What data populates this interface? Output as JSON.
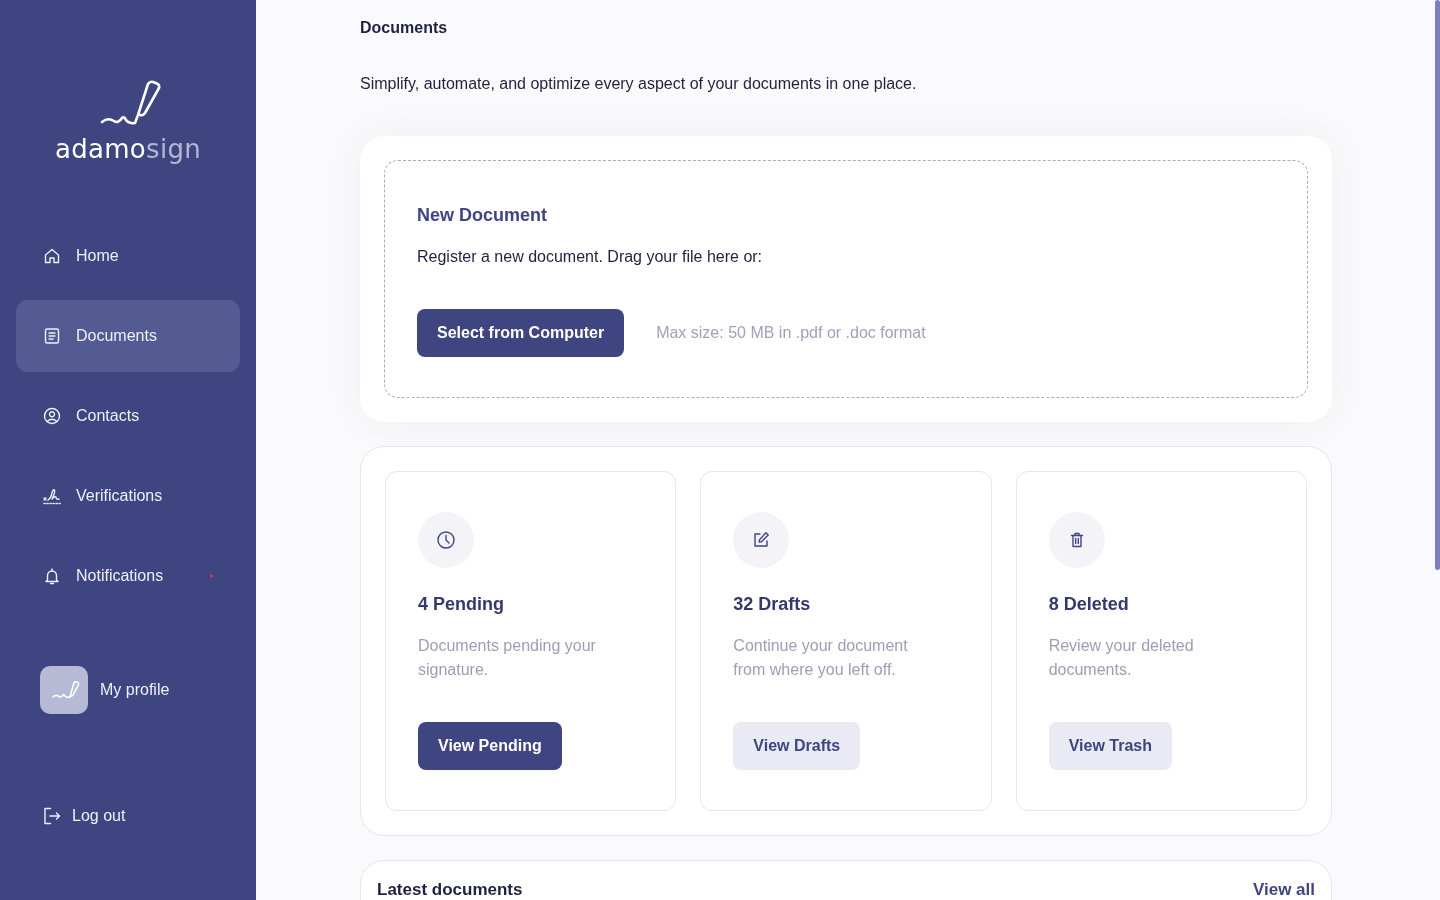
{
  "sidebar": {
    "logo": {
      "wordmark": "adamo",
      "wordmark_accent": "sign"
    },
    "nav_items": [
      {
        "label": "Home",
        "selected": false,
        "unread": false
      },
      {
        "label": "Documents",
        "selected": true,
        "unread": false
      },
      {
        "label": "Contacts",
        "selected": false,
        "unread": false
      },
      {
        "label": "Verifications",
        "selected": false,
        "unread": false
      },
      {
        "label": "Notifications",
        "selected": false,
        "unread": true
      }
    ],
    "profile": {
      "label": "My profile"
    },
    "logout": {
      "label": "Log out"
    }
  },
  "page": {
    "title": "Documents",
    "subtitle": "Simplify, automate, and optimize every aspect of your documents in one place."
  },
  "upload": {
    "title": "New Document",
    "description": "Register a new document. Drag your file here or:",
    "button": "Select from Computer",
    "hint": "Max size: 50 MB in .pdf or .doc format"
  },
  "summary_cards": [
    {
      "title": "4 Pending",
      "description": "Documents pending your signature.",
      "button": {
        "label": "View Pending",
        "kind": "primary"
      }
    },
    {
      "title": "32 Drafts",
      "description": "Continue your document from where you left off.",
      "button": {
        "label": "View Drafts",
        "kind": "secondary"
      }
    },
    {
      "title": "8 Deleted",
      "description": "Review your deleted documents.",
      "button": {
        "label": "View Trash",
        "kind": "secondary"
      }
    }
  ],
  "latest_documents": {
    "title": "Latest documents",
    "link": "View all"
  }
}
